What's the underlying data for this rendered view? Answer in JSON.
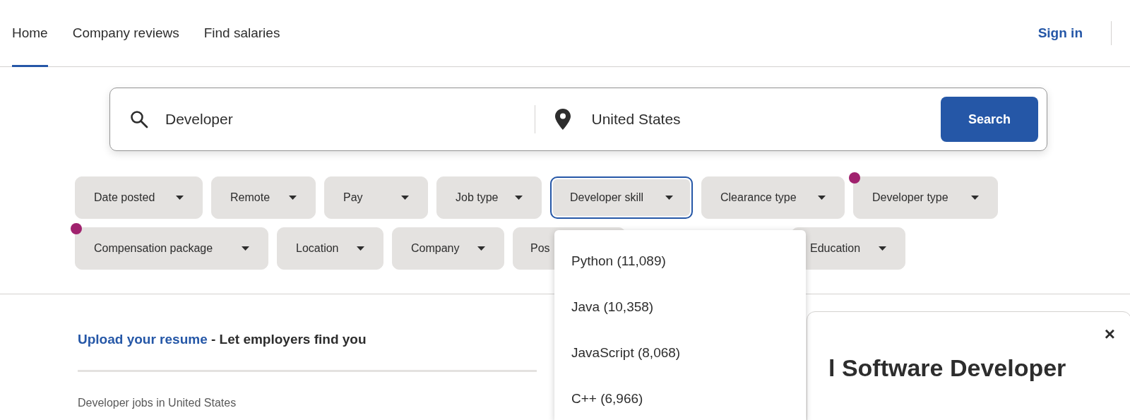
{
  "nav": {
    "tabs": [
      {
        "label": "Home",
        "selected": true
      },
      {
        "label": "Company reviews",
        "selected": false
      },
      {
        "label": "Find salaries",
        "selected": false
      }
    ],
    "sign_in": "Sign in"
  },
  "search": {
    "what": "Developer",
    "where": "United States",
    "button": "Search"
  },
  "filters": [
    {
      "label": "Date posted",
      "dot": false,
      "open": false
    },
    {
      "label": "Remote",
      "dot": false,
      "open": false
    },
    {
      "label": "Pay",
      "dot": false,
      "open": false
    },
    {
      "label": "Job type",
      "dot": false,
      "open": false
    },
    {
      "label": "Developer skill",
      "dot": false,
      "open": true
    },
    {
      "label": "Clearance type",
      "dot": false,
      "open": false
    },
    {
      "label": "Developer type",
      "dot": true,
      "open": false
    },
    {
      "label": "Compensation package",
      "dot": true,
      "open": false
    },
    {
      "label": "Location",
      "dot": false,
      "open": false
    },
    {
      "label": "Company",
      "dot": false,
      "open": false
    },
    {
      "label": "Pos",
      "dot": false,
      "open": false
    },
    {
      "label": "Education",
      "dot": false,
      "open": false
    }
  ],
  "dropdown": {
    "options": [
      "Python (11,089)",
      "Java (10,358)",
      "JavaScript (8,068)",
      "C++ (6,966)"
    ]
  },
  "resume": {
    "link": "Upload your resume",
    "text": "- Let employers find you"
  },
  "results_heading": "Developer jobs in United States",
  "job_card": {
    "title": "l Software Developer",
    "close": "×"
  }
}
